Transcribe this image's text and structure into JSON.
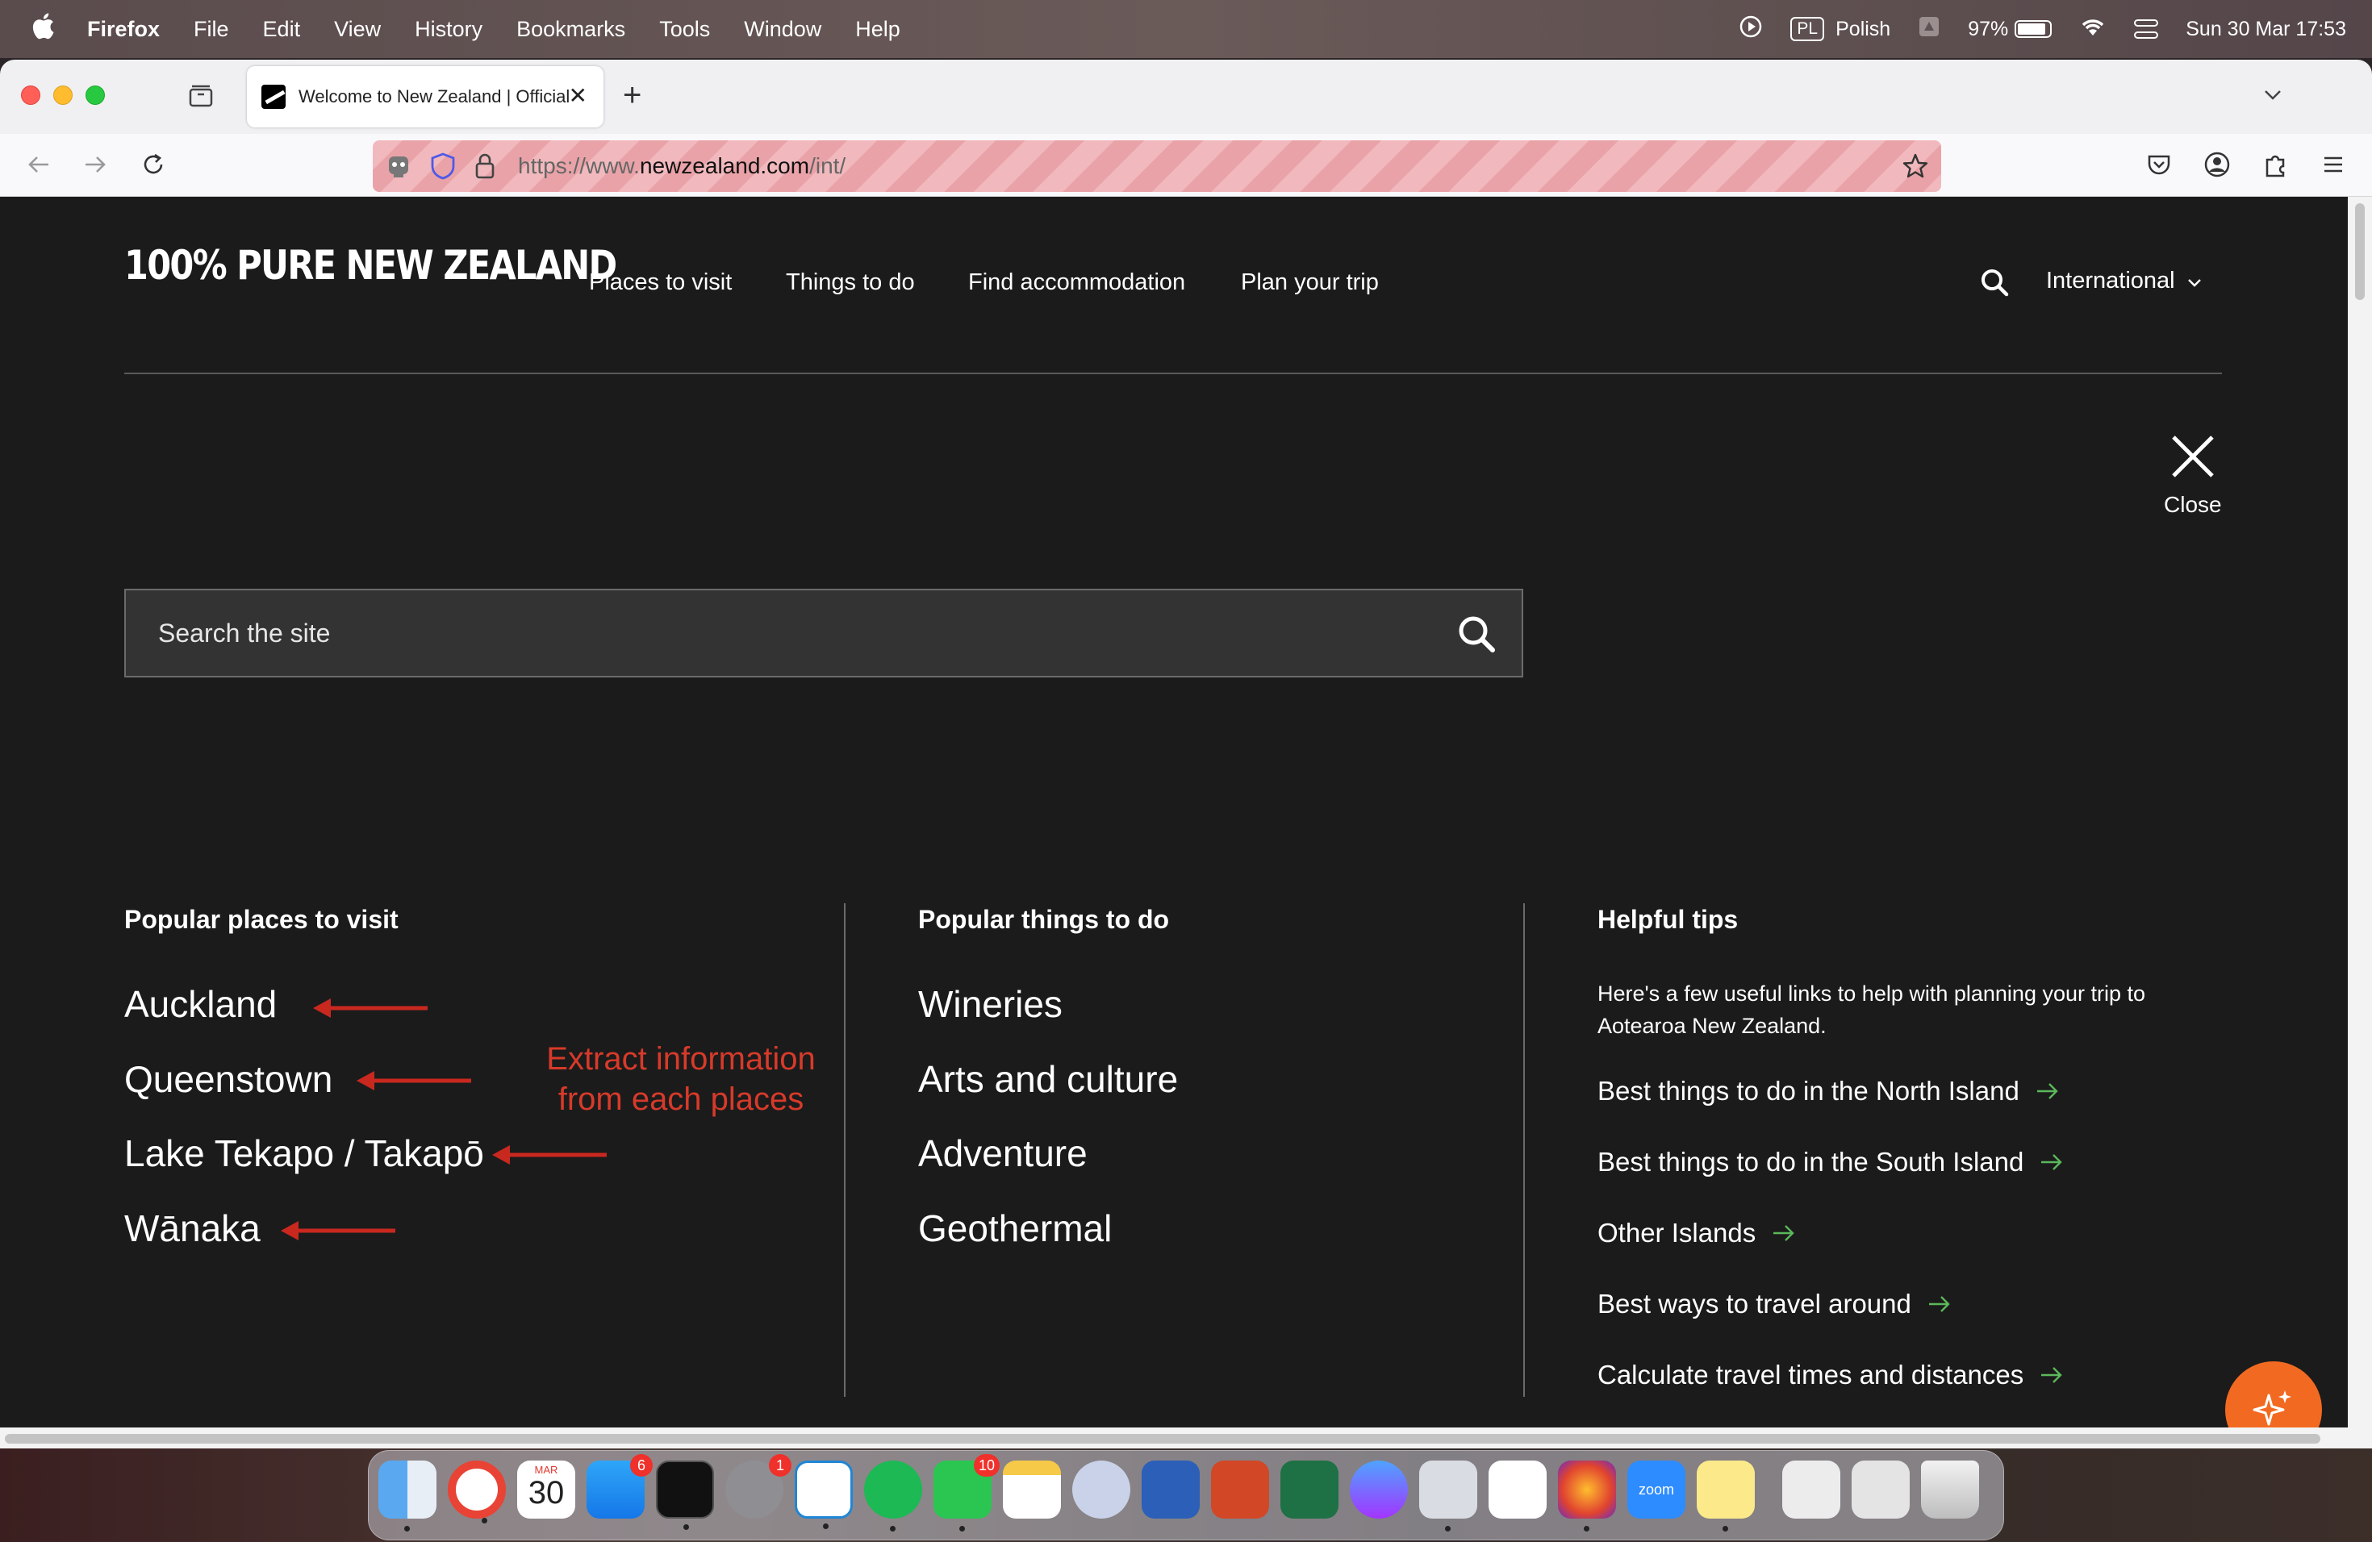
{
  "menubar": {
    "app_name": "Firefox",
    "menus": [
      "File",
      "Edit",
      "View",
      "History",
      "Bookmarks",
      "Tools",
      "Window",
      "Help"
    ],
    "input_source_badge": "PL",
    "input_source": "Polish",
    "battery": "97%",
    "datetime": "Sun 30 Mar  17:53"
  },
  "browser": {
    "tab_title": "Welcome to New Zealand | Official",
    "url_prefix": "https://www.",
    "url_host": "newzealand.com",
    "url_path": "/int/"
  },
  "site": {
    "logo": "100% PURE NEW ZEALAND",
    "nav": [
      "Places to visit",
      "Things to do",
      "Find accommodation",
      "Plan your trip"
    ],
    "locale": "International",
    "close_label": "Close",
    "search_placeholder": "Search the site",
    "columns": {
      "places": {
        "heading": "Popular places to visit",
        "items": [
          "Auckland",
          "Queenstown",
          "Lake Tekapo / Takapō",
          "Wānaka"
        ]
      },
      "things": {
        "heading": "Popular things to do",
        "items": [
          "Wineries",
          "Arts and culture",
          "Adventure",
          "Geothermal"
        ]
      },
      "tips": {
        "heading": "Helpful tips",
        "intro": "Here's a few useful links to help with planning your trip to Aotearoa New Zealand.",
        "links": [
          "Best things to do in the North Island",
          "Best things to do in the South Island",
          "Other Islands",
          "Best ways to travel around",
          "Calculate travel times and distances"
        ]
      }
    },
    "annotation": {
      "line1": "Extract information",
      "line2": "from each places",
      "color": "#d73a2a"
    },
    "accent_color": "#f26a21",
    "tip_arrow_color": "#5bb85b"
  },
  "dock": {
    "calendar_month": "MAR",
    "calendar_day": "30",
    "badges": {
      "app_store": "6",
      "system_settings": "1",
      "whatsapp": "10"
    },
    "zoom_label": "zoom"
  }
}
